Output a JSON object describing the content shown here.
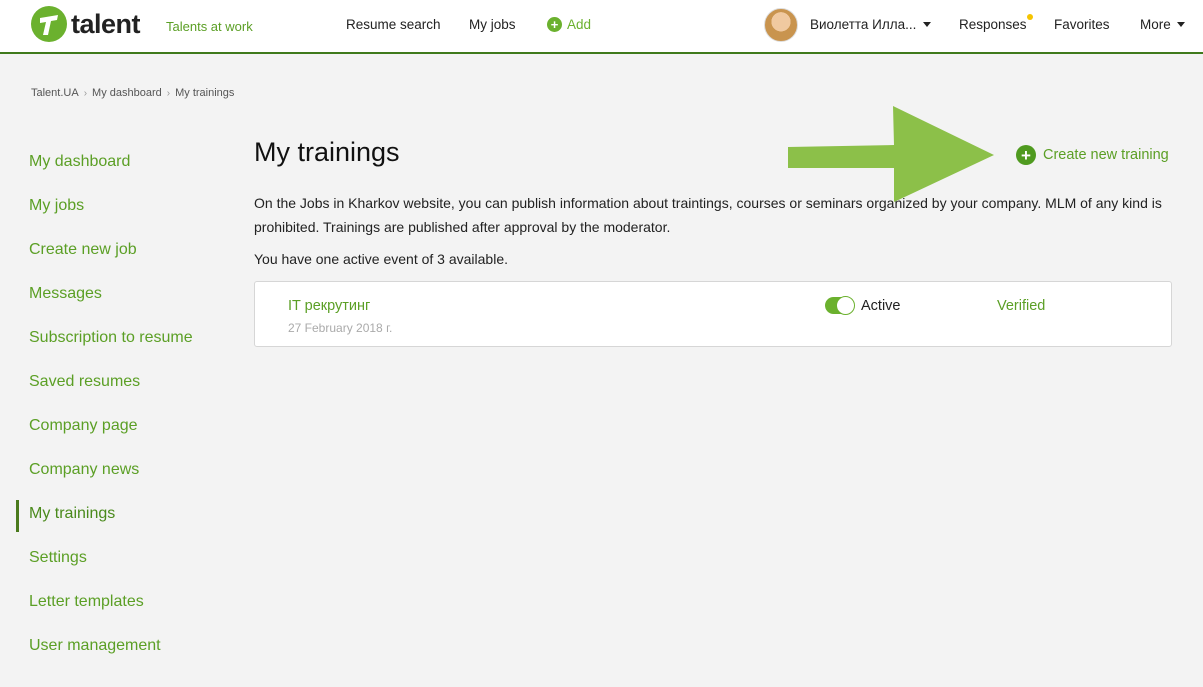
{
  "header": {
    "logo_text": "talent",
    "tagline": "Talents at work",
    "nav": {
      "resume_search": "Resume search",
      "my_jobs": "My jobs",
      "add": "Add"
    },
    "user_name": "Виолетта Илла...",
    "responses": "Responses",
    "favorites": "Favorites",
    "more": "More"
  },
  "breadcrumb": [
    "Talent.UA",
    "My dashboard",
    "My trainings"
  ],
  "sidebar": {
    "items": [
      {
        "label": "My dashboard"
      },
      {
        "label": "My jobs"
      },
      {
        "label": "Create new job"
      },
      {
        "label": "Messages"
      },
      {
        "label": "Subscription to resume"
      },
      {
        "label": "Saved resumes"
      },
      {
        "label": "Company page"
      },
      {
        "label": "Company news"
      },
      {
        "label": "My trainings"
      },
      {
        "label": "Settings"
      },
      {
        "label": "Letter templates"
      },
      {
        "label": "User management"
      }
    ],
    "active_index": 8
  },
  "main": {
    "title": "My trainings",
    "create_label": "Create new training",
    "description": "On the Jobs in Kharkov website, you can publish information about traintings, courses or seminars organized by your company. MLM of any kind is prohibited. Trainings are published after approval by the moderator.",
    "active_count": "You have one active event of 3 available.",
    "trainings": [
      {
        "title": "IT рекрутинг",
        "date": "27 February 2018 г.",
        "status": "Active",
        "toggle_on": true,
        "moderation": "Verified"
      }
    ]
  },
  "colors": {
    "accent": "#6bb12e",
    "link": "#5b9f25",
    "header_border": "#3f7a1c",
    "notification_dot": "#f5c400",
    "arrow": "#86bd3f"
  },
  "icons": {
    "logo": "talent-logo-icon",
    "add": "plus-circle-icon",
    "user_menu": "caret-down-icon",
    "notification": "dot-icon",
    "annotation": "arrow-right-icon"
  }
}
